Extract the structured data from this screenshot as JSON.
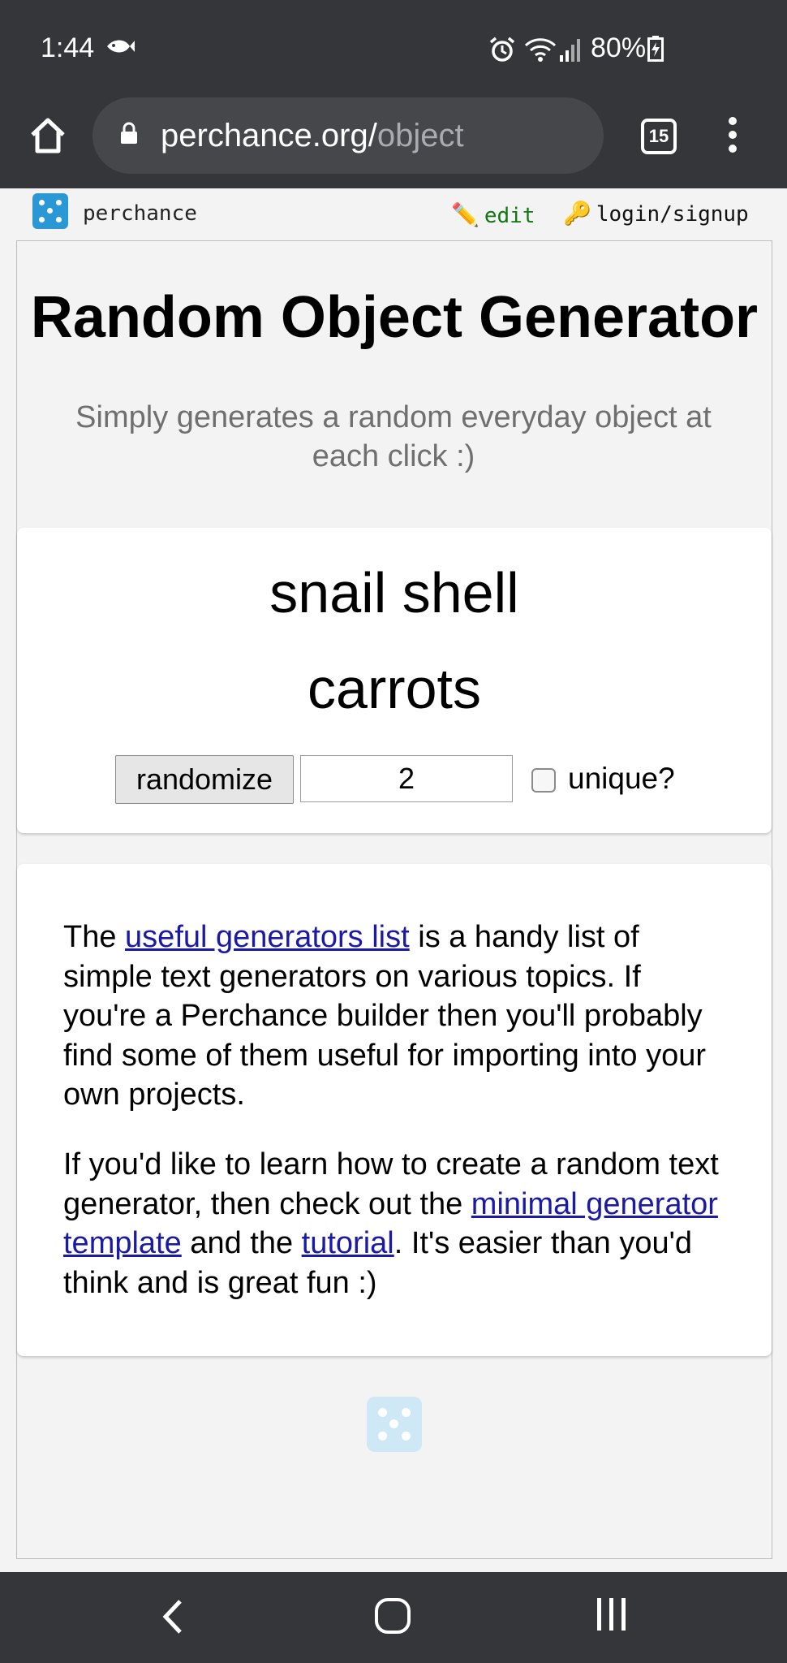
{
  "status_bar": {
    "time": "1:44",
    "battery": "80%"
  },
  "browser": {
    "url_host": "perchance.org/",
    "url_path": "object",
    "tab_count": "15"
  },
  "site_header": {
    "brand": "perchance",
    "edit_label": "edit",
    "login_label": "login/signup"
  },
  "page": {
    "title": "Random Object Generator",
    "subtitle": "Simply generates a random everyday object at each click :)"
  },
  "generator": {
    "results": [
      "snail shell",
      "carrots"
    ],
    "randomize_label": "randomize",
    "count_value": "2",
    "unique_label": "unique?",
    "unique_checked": false
  },
  "info": {
    "p1_before": "The ",
    "p1_link": "useful generators list",
    "p1_after": " is a handy list of simple text generators on various topics. If you're a Perchance builder then you'll probably find some of them useful for importing into your own projects.",
    "p2_before": "If you'd like to learn how to create a random text generator, then check out the ",
    "p2_link1": "minimal generator template",
    "p2_mid": " and the ",
    "p2_link2": "tutorial",
    "p2_after": ". It's easier than you'd think and is great fun :)"
  },
  "colors": {
    "chrome_dark": "#35363a",
    "link": "#1a1aa6",
    "edit_green": "#117711",
    "die_blue": "#2b98d6"
  }
}
